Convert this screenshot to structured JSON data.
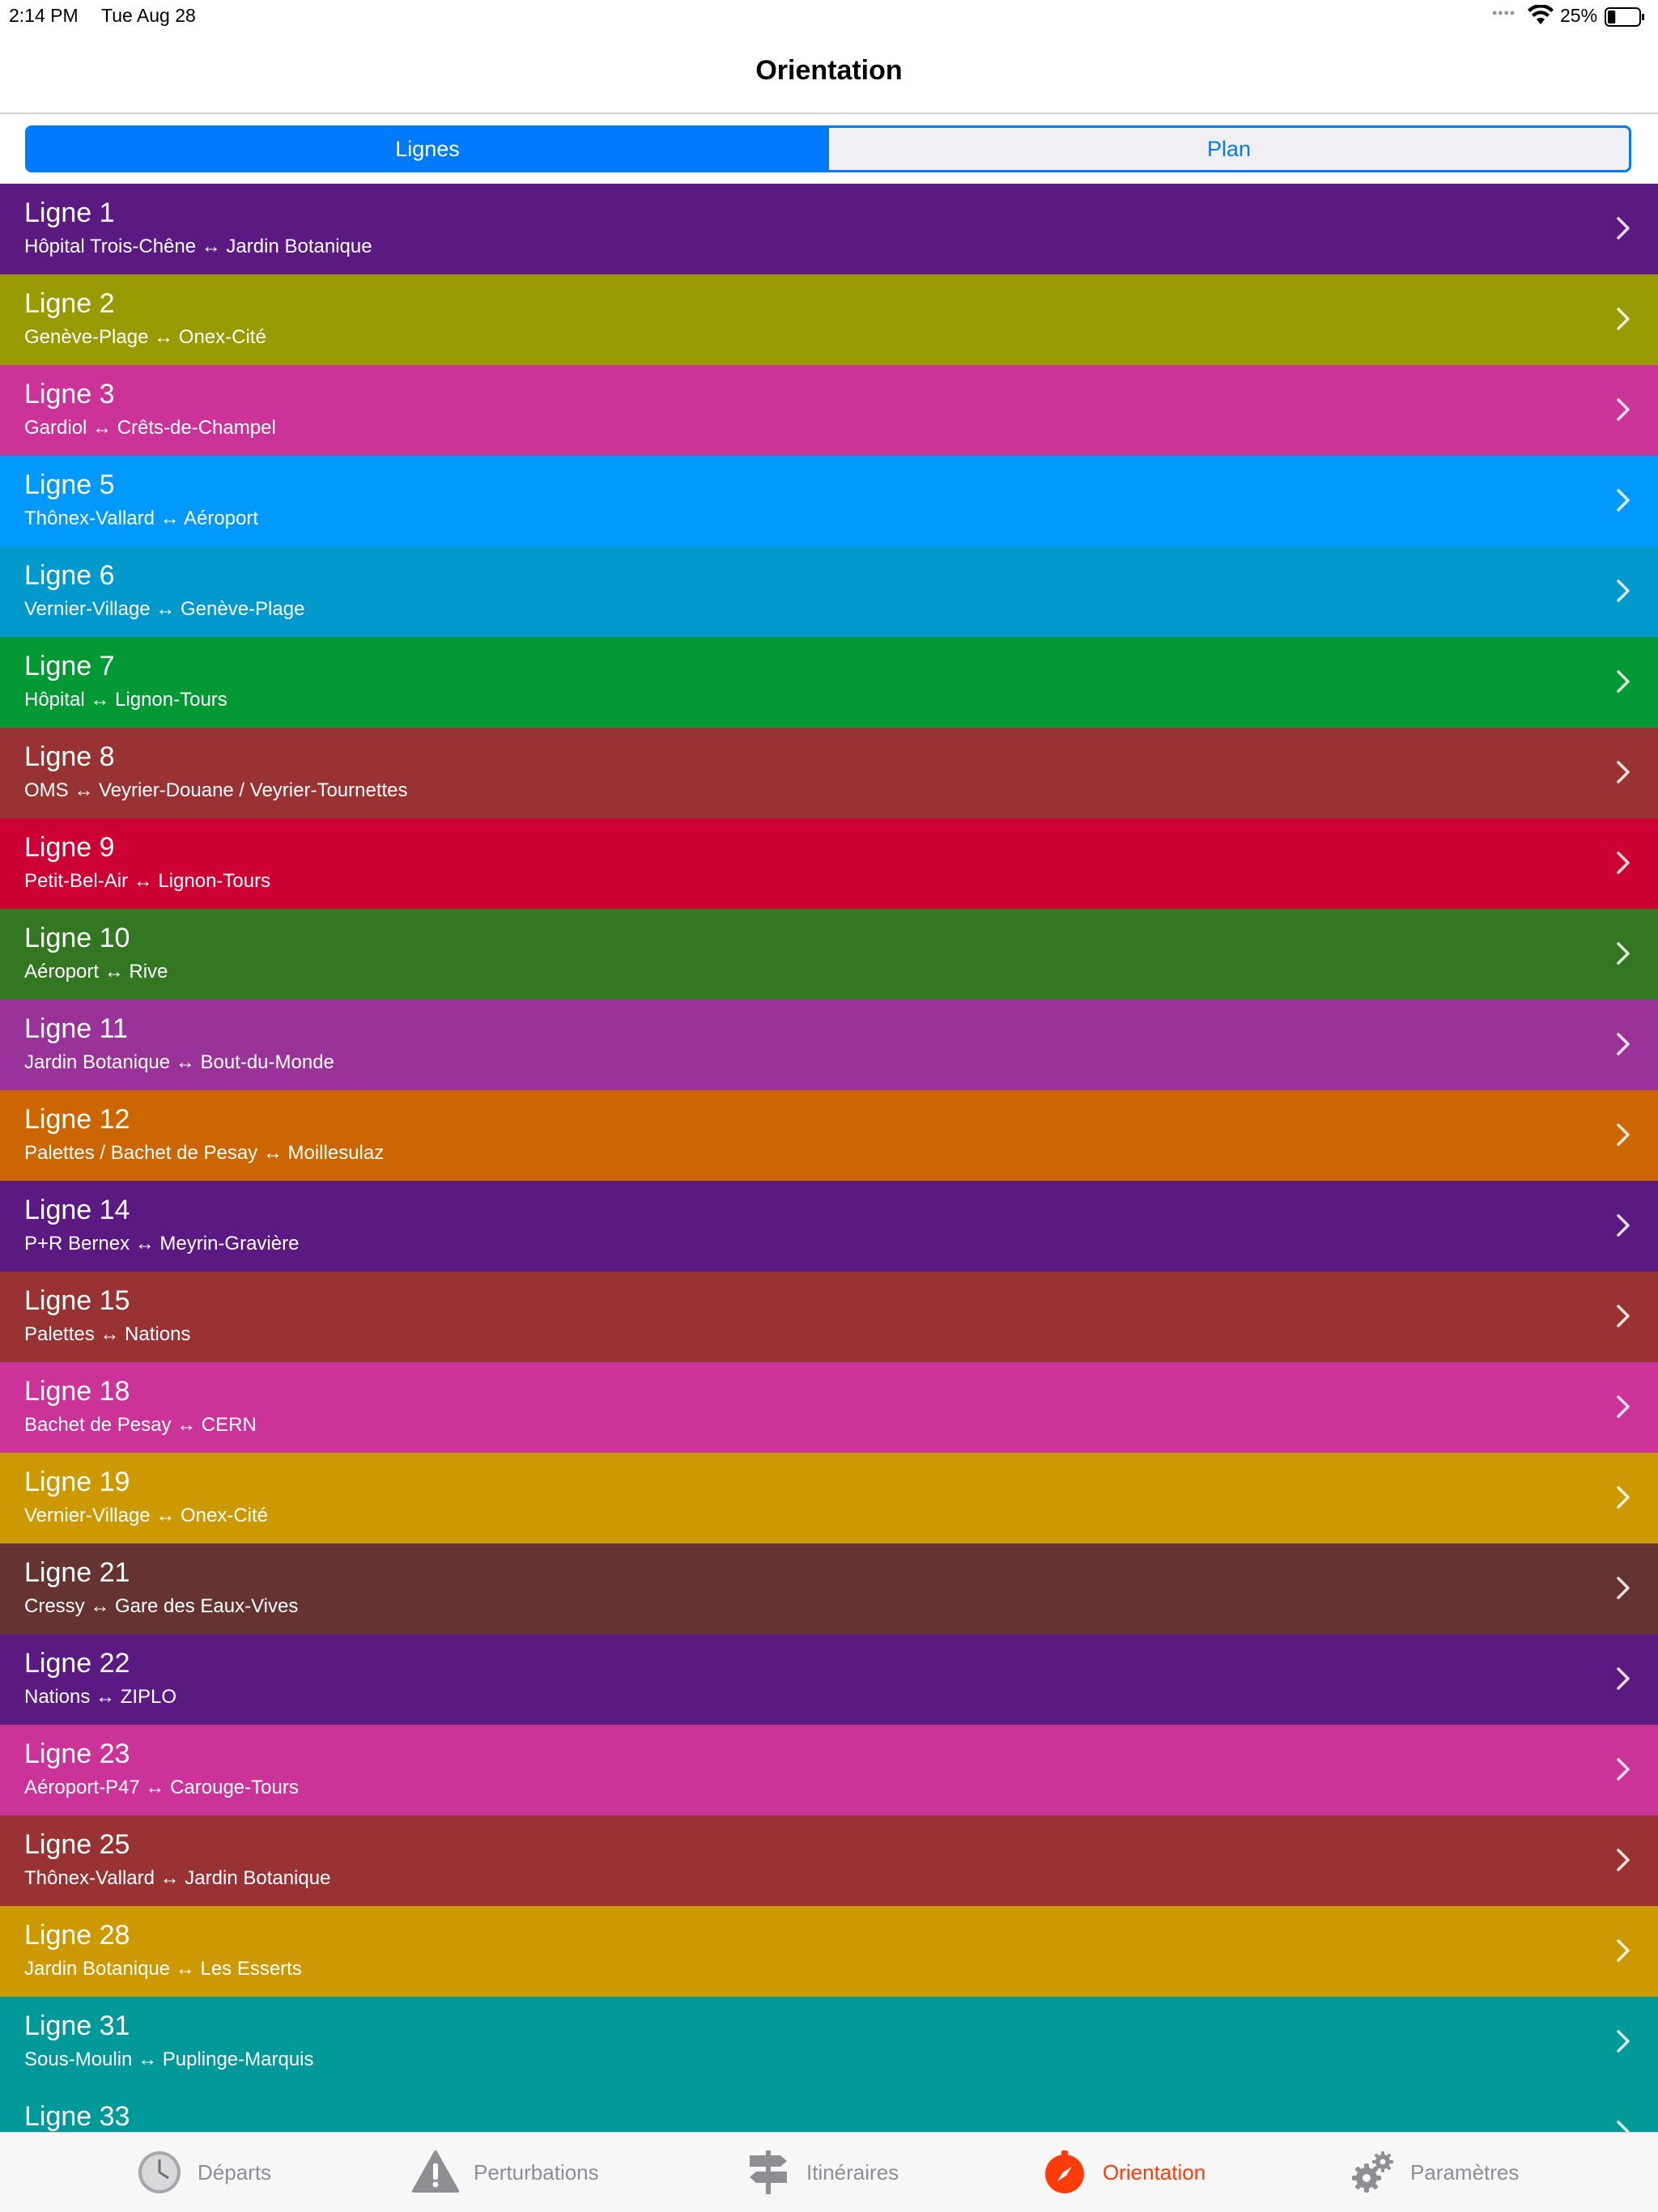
{
  "status_bar": {
    "time": "2:14 PM",
    "date": "Tue Aug 28",
    "signal": "••••",
    "battery_percent": "25%",
    "battery_level": 0.25
  },
  "nav": {
    "title": "Orientation"
  },
  "segments": {
    "lines_label": "Lignes",
    "plan_label": "Plan",
    "selected": "Lignes"
  },
  "lines": [
    {
      "name": "Ligne 1",
      "route": "Hôpital Trois-Chêne ↔ Jardin Botanique",
      "color": "#5a1a82"
    },
    {
      "name": "Ligne 2",
      "route": "Genève-Plage ↔ Onex-Cité",
      "color": "#999900"
    },
    {
      "name": "Ligne 3",
      "route": "Gardiol ↔ Crêts-de-Champel",
      "color": "#cc3399"
    },
    {
      "name": "Ligne 5",
      "route": "Thônex-Vallard ↔ Aéroport",
      "color": "#0099ff"
    },
    {
      "name": "Ligne 6",
      "route": "Vernier-Village ↔ Genève-Plage",
      "color": "#0099cc"
    },
    {
      "name": "Ligne 7",
      "route": "Hôpital ↔ Lignon-Tours",
      "color": "#009933"
    },
    {
      "name": "Ligne 8",
      "route": "OMS ↔ Veyrier-Douane / Veyrier-Tournettes",
      "color": "#993333"
    },
    {
      "name": "Ligne 9",
      "route": "Petit-Bel-Air ↔ Lignon-Tours",
      "color": "#cc0033"
    },
    {
      "name": "Ligne 10",
      "route": "Aéroport ↔ Rive",
      "color": "#337722"
    },
    {
      "name": "Ligne 11",
      "route": "Jardin Botanique ↔ Bout-du-Monde",
      "color": "#993399"
    },
    {
      "name": "Ligne 12",
      "route": "Palettes / Bachet de Pesay ↔ Moillesulaz",
      "color": "#cc6600"
    },
    {
      "name": "Ligne 14",
      "route": "P+R Bernex ↔ Meyrin-Gravière",
      "color": "#5a1a82"
    },
    {
      "name": "Ligne 15",
      "route": "Palettes ↔ Nations",
      "color": "#993333"
    },
    {
      "name": "Ligne 18",
      "route": "Bachet de Pesay ↔ CERN",
      "color": "#cc3399"
    },
    {
      "name": "Ligne 19",
      "route": "Vernier-Village ↔ Onex-Cité",
      "color": "#cc9900"
    },
    {
      "name": "Ligne 21",
      "route": "Cressy ↔ Gare des Eaux-Vives",
      "color": "#663333"
    },
    {
      "name": "Ligne 22",
      "route": "Nations ↔ ZIPLO",
      "color": "#5a1a82"
    },
    {
      "name": "Ligne 23",
      "route": "Aéroport-P47 ↔ Carouge-Tours",
      "color": "#cc3399"
    },
    {
      "name": "Ligne 25",
      "route": "Thônex-Vallard ↔ Jardin Botanique",
      "color": "#993333"
    },
    {
      "name": "Ligne 28",
      "route": "Jardin Botanique ↔ Les Esserts",
      "color": "#cc9900"
    },
    {
      "name": "Ligne 31",
      "route": "Sous-Moulin ↔ Puplinge-Marquis",
      "color": "#009999"
    },
    {
      "name": "Ligne 33",
      "route": "",
      "color": "#009999"
    }
  ],
  "tabs": [
    {
      "label": "Départs",
      "icon": "clock-icon",
      "active": false
    },
    {
      "label": "Perturbations",
      "icon": "warning-icon",
      "active": false
    },
    {
      "label": "Itinéraires",
      "icon": "signpost-icon",
      "active": false
    },
    {
      "label": "Orientation",
      "icon": "compass-icon",
      "active": true
    },
    {
      "label": "Paramètres",
      "icon": "gears-icon",
      "active": false
    }
  ],
  "colors": {
    "accent": "#007aff",
    "tab_active": "#ff3b0a",
    "tab_inactive": "#8e8e93"
  }
}
